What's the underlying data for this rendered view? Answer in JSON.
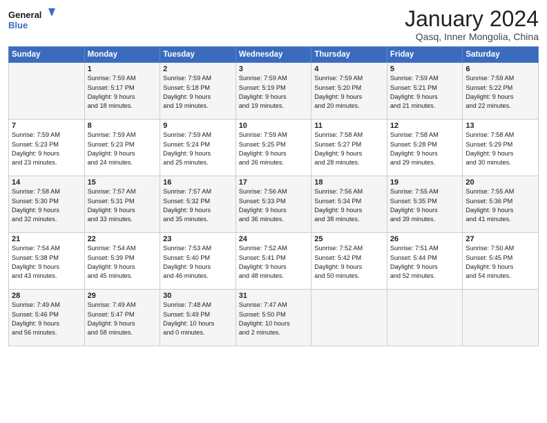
{
  "header": {
    "logo_line1": "General",
    "logo_line2": "Blue",
    "month": "January 2024",
    "location": "Qasq, Inner Mongolia, China"
  },
  "days_of_week": [
    "Sunday",
    "Monday",
    "Tuesday",
    "Wednesday",
    "Thursday",
    "Friday",
    "Saturday"
  ],
  "weeks": [
    [
      {
        "day": "",
        "info": ""
      },
      {
        "day": "1",
        "info": "Sunrise: 7:59 AM\nSunset: 5:17 PM\nDaylight: 9 hours\nand 18 minutes."
      },
      {
        "day": "2",
        "info": "Sunrise: 7:59 AM\nSunset: 5:18 PM\nDaylight: 9 hours\nand 19 minutes."
      },
      {
        "day": "3",
        "info": "Sunrise: 7:59 AM\nSunset: 5:19 PM\nDaylight: 9 hours\nand 19 minutes."
      },
      {
        "day": "4",
        "info": "Sunrise: 7:59 AM\nSunset: 5:20 PM\nDaylight: 9 hours\nand 20 minutes."
      },
      {
        "day": "5",
        "info": "Sunrise: 7:59 AM\nSunset: 5:21 PM\nDaylight: 9 hours\nand 21 minutes."
      },
      {
        "day": "6",
        "info": "Sunrise: 7:59 AM\nSunset: 5:22 PM\nDaylight: 9 hours\nand 22 minutes."
      }
    ],
    [
      {
        "day": "7",
        "info": "Sunrise: 7:59 AM\nSunset: 5:23 PM\nDaylight: 9 hours\nand 23 minutes."
      },
      {
        "day": "8",
        "info": "Sunrise: 7:59 AM\nSunset: 5:23 PM\nDaylight: 9 hours\nand 24 minutes."
      },
      {
        "day": "9",
        "info": "Sunrise: 7:59 AM\nSunset: 5:24 PM\nDaylight: 9 hours\nand 25 minutes."
      },
      {
        "day": "10",
        "info": "Sunrise: 7:59 AM\nSunset: 5:25 PM\nDaylight: 9 hours\nand 26 minutes."
      },
      {
        "day": "11",
        "info": "Sunrise: 7:58 AM\nSunset: 5:27 PM\nDaylight: 9 hours\nand 28 minutes."
      },
      {
        "day": "12",
        "info": "Sunrise: 7:58 AM\nSunset: 5:28 PM\nDaylight: 9 hours\nand 29 minutes."
      },
      {
        "day": "13",
        "info": "Sunrise: 7:58 AM\nSunset: 5:29 PM\nDaylight: 9 hours\nand 30 minutes."
      }
    ],
    [
      {
        "day": "14",
        "info": "Sunrise: 7:58 AM\nSunset: 5:30 PM\nDaylight: 9 hours\nand 32 minutes."
      },
      {
        "day": "15",
        "info": "Sunrise: 7:57 AM\nSunset: 5:31 PM\nDaylight: 9 hours\nand 33 minutes."
      },
      {
        "day": "16",
        "info": "Sunrise: 7:57 AM\nSunset: 5:32 PM\nDaylight: 9 hours\nand 35 minutes."
      },
      {
        "day": "17",
        "info": "Sunrise: 7:56 AM\nSunset: 5:33 PM\nDaylight: 9 hours\nand 36 minutes."
      },
      {
        "day": "18",
        "info": "Sunrise: 7:56 AM\nSunset: 5:34 PM\nDaylight: 9 hours\nand 38 minutes."
      },
      {
        "day": "19",
        "info": "Sunrise: 7:55 AM\nSunset: 5:35 PM\nDaylight: 9 hours\nand 39 minutes."
      },
      {
        "day": "20",
        "info": "Sunrise: 7:55 AM\nSunset: 5:36 PM\nDaylight: 9 hours\nand 41 minutes."
      }
    ],
    [
      {
        "day": "21",
        "info": "Sunrise: 7:54 AM\nSunset: 5:38 PM\nDaylight: 9 hours\nand 43 minutes."
      },
      {
        "day": "22",
        "info": "Sunrise: 7:54 AM\nSunset: 5:39 PM\nDaylight: 9 hours\nand 45 minutes."
      },
      {
        "day": "23",
        "info": "Sunrise: 7:53 AM\nSunset: 5:40 PM\nDaylight: 9 hours\nand 46 minutes."
      },
      {
        "day": "24",
        "info": "Sunrise: 7:52 AM\nSunset: 5:41 PM\nDaylight: 9 hours\nand 48 minutes."
      },
      {
        "day": "25",
        "info": "Sunrise: 7:52 AM\nSunset: 5:42 PM\nDaylight: 9 hours\nand 50 minutes."
      },
      {
        "day": "26",
        "info": "Sunrise: 7:51 AM\nSunset: 5:44 PM\nDaylight: 9 hours\nand 52 minutes."
      },
      {
        "day": "27",
        "info": "Sunrise: 7:50 AM\nSunset: 5:45 PM\nDaylight: 9 hours\nand 54 minutes."
      }
    ],
    [
      {
        "day": "28",
        "info": "Sunrise: 7:49 AM\nSunset: 5:46 PM\nDaylight: 9 hours\nand 56 minutes."
      },
      {
        "day": "29",
        "info": "Sunrise: 7:49 AM\nSunset: 5:47 PM\nDaylight: 9 hours\nand 58 minutes."
      },
      {
        "day": "30",
        "info": "Sunrise: 7:48 AM\nSunset: 5:49 PM\nDaylight: 10 hours\nand 0 minutes."
      },
      {
        "day": "31",
        "info": "Sunrise: 7:47 AM\nSunset: 5:50 PM\nDaylight: 10 hours\nand 2 minutes."
      },
      {
        "day": "",
        "info": ""
      },
      {
        "day": "",
        "info": ""
      },
      {
        "day": "",
        "info": ""
      }
    ]
  ]
}
